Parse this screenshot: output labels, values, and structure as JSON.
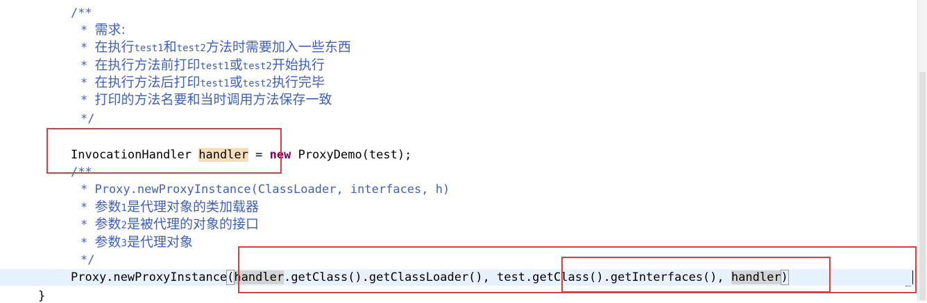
{
  "editor": {
    "comment1": {
      "open": "/**",
      "line1_prefix": "* ",
      "line1_text": "需求:",
      "line2_prefix": "* ",
      "line2_a": "在执行",
      "line2_b": "test1",
      "line2_c": "和",
      "line2_d": "test2",
      "line2_e": "方法时需要加入一些东西",
      "line3_prefix": "* ",
      "line3_a": "在执行方法前打印",
      "line3_b": "test1",
      "line3_c": "或",
      "line3_d": "test2",
      "line3_e": "开始执行",
      "line4_prefix": "* ",
      "line4_a": "在执行方法后打印",
      "line4_b": "test1",
      "line4_c": "或",
      "line4_d": "test2",
      "line4_e": "执行完毕",
      "line5_prefix": "* ",
      "line5_text": "打印的方法名要和当时调用方法保存一致",
      "close": "*/"
    },
    "handler_line": {
      "type": "InvocationHandler ",
      "var": "handler",
      "eq": " = ",
      "kw_new": "new",
      "rest": " ProxyDemo(test);"
    },
    "comment2": {
      "open": "/**",
      "line1": "* Proxy.newProxyInstance(ClassLoader, interfaces, h)",
      "line2_prefix": "* ",
      "line2_a": "参数",
      "line2_b": "1",
      "line2_c": "是代理对象的类加载器",
      "line3_prefix": "* ",
      "line3_a": "参数",
      "line3_b": "2",
      "line3_c": "是被代理的对象的接口",
      "line4_prefix": "* ",
      "line4_a": "参数",
      "line4_b": "3",
      "line4_c": "是代理对象",
      "close": "*/"
    },
    "proxy_line": {
      "call": "Proxy.newProxyInstance",
      "paren_open": "(",
      "arg1_var": "handler",
      "arg1_rest": ".getClass().getClassLoader(), ",
      "arg2": "test.getClass().getInterfaces()",
      "sep": ", ",
      "arg3": "handler",
      "paren_close": ")"
    },
    "closing_brace": "}"
  },
  "colors": {
    "comment": "#3f5fbf",
    "keyword": "#7f0055",
    "annotation_box": "#e53a3a",
    "occurrence_highlight": "#f6dfb8",
    "current_line": "#e8f2fe"
  }
}
